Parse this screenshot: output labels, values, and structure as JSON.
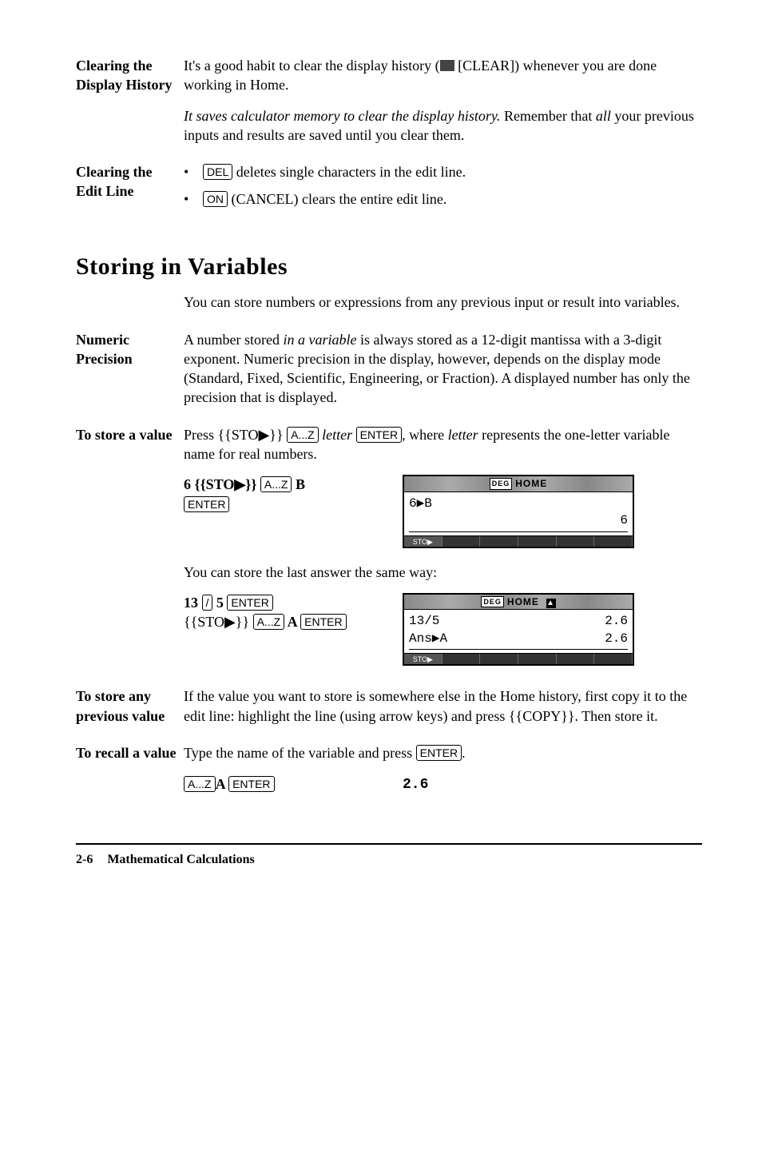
{
  "sections": {
    "clearHistory": {
      "label": "Clearing the Display History",
      "p1a": "It's a good habit to clear the display history (",
      "p1b": " [CLEAR]) whenever you are done working in Home.",
      "p2a": "It saves calculator memory to clear the display history.",
      "p2b": " Remember that ",
      "p2c": "all",
      "p2d": " your previous inputs and results are saved until you clear them."
    },
    "clearEdit": {
      "label": "Clearing the Edit Line",
      "b1a": " deletes single characters in the edit line.",
      "b2a": " (CANCEL) clears the entire edit line."
    },
    "storingHeading": "Storing in Variables",
    "storingIntro": "You can store numbers or expressions from any previous input or result into variables.",
    "numericPrecision": {
      "label": "Numeric Precision",
      "body_a": "A number stored ",
      "body_b": "in a variable",
      "body_c": " is always stored as a 12-digit mantissa with a 3-digit exponent. Numeric precision in the display, however, depends on the display mode (Standard, Fixed, Scientific, Engineering, or Fraction). A displayed number has only the precision that is displayed."
    },
    "toStore": {
      "label": "To store a value",
      "body_a": "Press {{STO▶}} ",
      "body_b": " ",
      "body_c": "letter",
      "body_d": " ",
      "body_e": ", where ",
      "body_f": "letter",
      "body_g": " represents the one-letter variable name for real numbers."
    },
    "example1": {
      "left_a": "6 {{STO▶}} ",
      "left_b": " B",
      "screen": {
        "title_deg": "DEG",
        "title_main": "HOME",
        "line1_left": "6▶B",
        "line1_right": "6",
        "menu1": "STO▶"
      }
    },
    "storeLast": "You can store the last answer the same way:",
    "example2": {
      "left_a": "13 ",
      "left_b": " 5 ",
      "left_c": "{{STO▶}} ",
      "left_d": " A ",
      "screen": {
        "title_deg": "DEG",
        "title_main": "HOME",
        "row1_left": "13/5",
        "row1_right": "2.6",
        "row2_left": "Ans▶A",
        "row2_right": "2.6",
        "menu1": "STO▶"
      }
    },
    "storeAny": {
      "label": "To store any previous value",
      "body": "If the value you want to store is somewhere else in the Home history, first copy it to the edit line: highlight the line (using arrow keys) and press {{COPY}}. Then store it."
    },
    "recall": {
      "label": "To recall a value",
      "body_a": "Type the name of the variable and press ",
      "body_b": ".",
      "example_left_a": "A ",
      "example_result": "2.6"
    }
  },
  "keys": {
    "del": "DEL",
    "on": "ON",
    "az": "A...Z",
    "enter": "ENTER",
    "slash": "/"
  },
  "footer": {
    "page": "2-6",
    "title": "Mathematical Calculations"
  }
}
